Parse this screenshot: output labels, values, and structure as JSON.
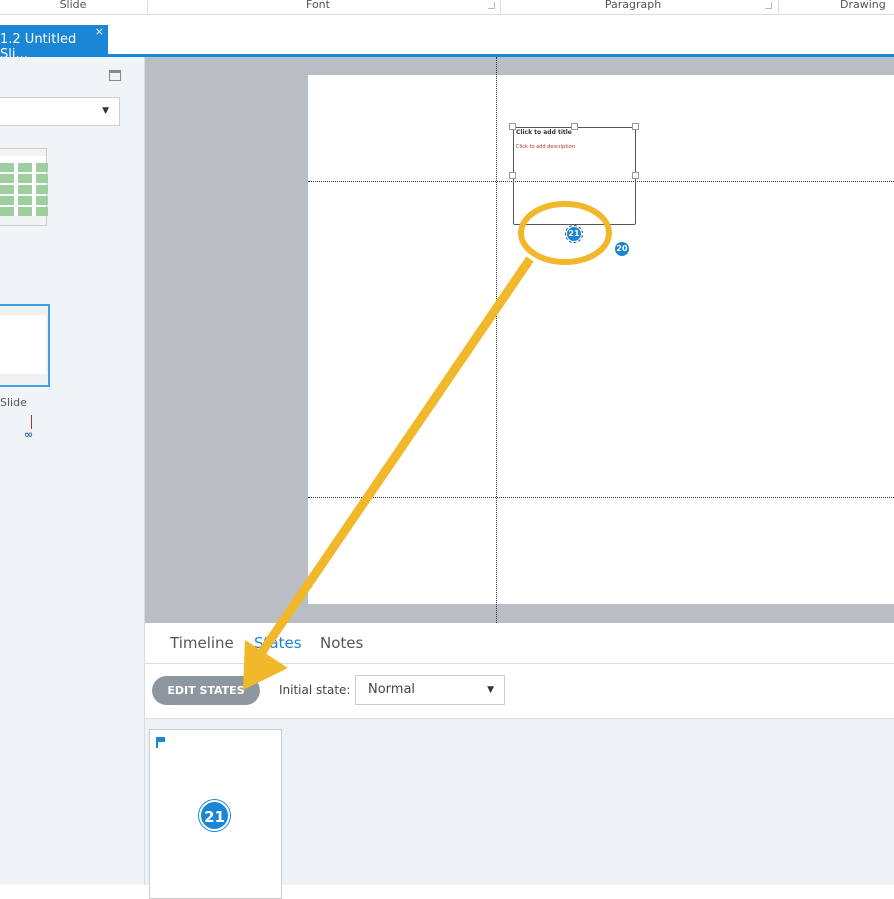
{
  "ribbon": {
    "groups": [
      "Slide",
      "Font",
      "Paragraph",
      "Drawing"
    ]
  },
  "tab": {
    "title": "1.2 Untitled Sli...",
    "close": "×"
  },
  "left_panel": {
    "thumb_label": "Slide"
  },
  "slide": {
    "title_placeholder": "Click to add title",
    "desc_placeholder": "Click to add description",
    "badge_selected": "21",
    "badge_other": "20"
  },
  "bottom": {
    "tabs": [
      "Timeline",
      "States",
      "Notes"
    ],
    "active_tab": "States",
    "edit_states": "EDIT STATES",
    "initial_state_label": "Initial state:",
    "initial_state_value": "Normal",
    "state_badge": "21"
  },
  "colors": {
    "accent": "#1a86d6",
    "highlight": "#f0b82a"
  }
}
